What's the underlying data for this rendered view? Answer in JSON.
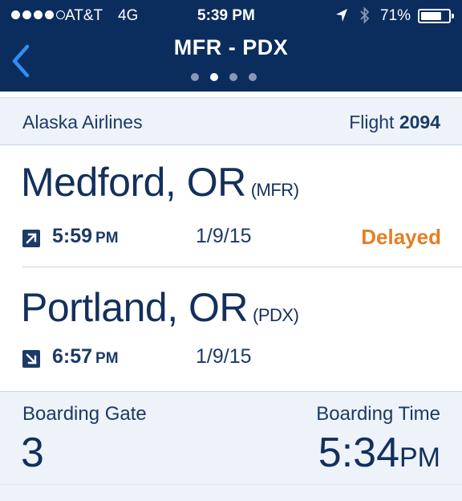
{
  "status_bar": {
    "carrier": "AT&T",
    "network": "4G",
    "time": "5:39 PM",
    "battery": "71%",
    "battery_level": 0.71,
    "signal_bars_filled": 4,
    "signal_bars_total": 5
  },
  "nav": {
    "title": "MFR - PDX",
    "page_count": 4,
    "active_page_index": 1
  },
  "flight": {
    "airline": "Alaska Airlines",
    "flight_label": "Flight",
    "flight_number": "2094"
  },
  "departure": {
    "city": "Medford, OR",
    "code": "(MFR)",
    "time": "5:59",
    "ampm": "PM",
    "date": "1/9/15",
    "status": "Delayed",
    "icon": "departure-arrow-icon"
  },
  "arrival": {
    "city": "Portland, OR",
    "code": "(PDX)",
    "time": "6:57",
    "ampm": "PM",
    "date": "1/9/15",
    "icon": "arrival-arrow-icon"
  },
  "boarding": {
    "gate_label": "Boarding Gate",
    "gate_value": "3",
    "time_label": "Boarding Time",
    "time_value": "5:34",
    "time_ampm": "PM"
  },
  "colors": {
    "header_bg": "#0b2d5e",
    "accent_blue": "#2f8ef4",
    "delayed": "#e57e23",
    "text_navy": "#13305c",
    "panel_bg": "#eef3fa"
  }
}
